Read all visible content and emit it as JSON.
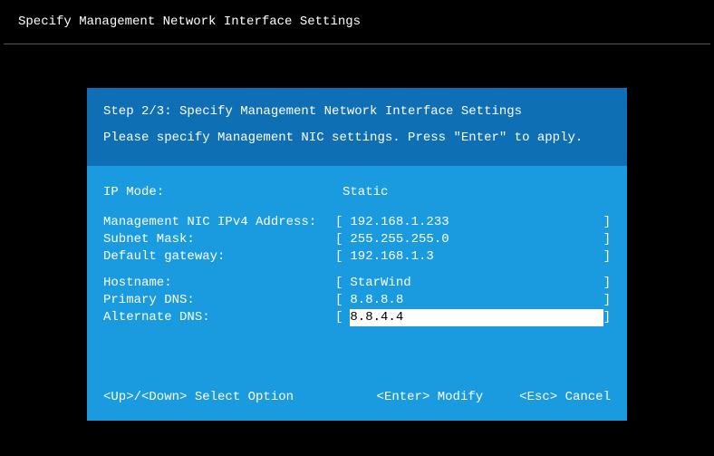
{
  "header": {
    "title": "Specify Management Network Interface Settings"
  },
  "dialog": {
    "step_title": "Step 2/3: Specify Management Network Interface Settings",
    "instruction": "Please specify Management NIC settings. Press \"Enter\" to apply.",
    "fields": {
      "ip_mode": {
        "label": "IP Mode:",
        "value": "Static"
      },
      "ipv4": {
        "label": "Management NIC IPv4 Address:",
        "value": "192.168.1.233"
      },
      "subnet": {
        "label": "Subnet Mask:",
        "value": "255.255.255.0"
      },
      "gateway": {
        "label": "Default gateway:",
        "value": "192.168.1.3"
      },
      "hostname": {
        "label": "Hostname:",
        "value": "StarWind"
      },
      "primary_dns": {
        "label": "Primary DNS:",
        "value": "8.8.8.8"
      },
      "alt_dns": {
        "label": "Alternate DNS:",
        "value": "8.8.4.4"
      }
    },
    "footer": {
      "select": "<Up>/<Down> Select Option",
      "modify": "<Enter> Modify",
      "cancel": "<Esc> Cancel"
    }
  }
}
